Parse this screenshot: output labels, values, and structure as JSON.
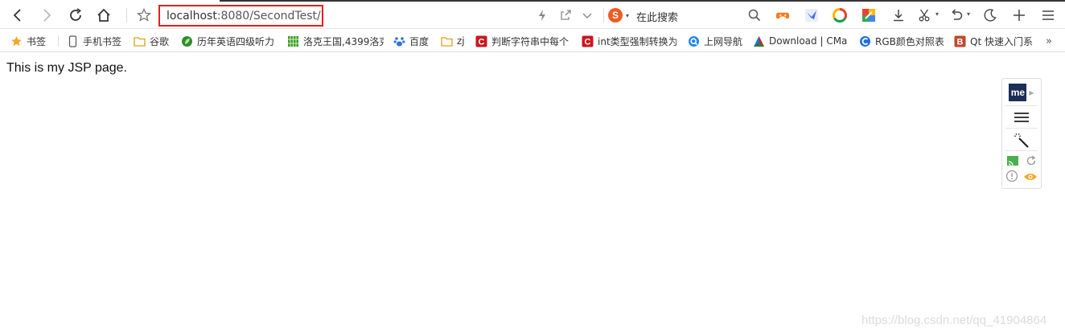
{
  "browser": {
    "address_host": "localhost",
    "address_rest": ":8080/SecondTest/",
    "search_engine_label": "在此搜索",
    "icons": [
      "back-icon",
      "forward-icon",
      "reload-icon",
      "home-icon",
      "star-icon",
      "lightning-icon",
      "share-icon",
      "chevron-down-icon",
      "sogou-icon",
      "search-icon",
      "game-icon",
      "bird-icon",
      "chrome-ring-icon",
      "colorful-icon",
      "download-icon",
      "scissors-icon",
      "undo-icon",
      "moon-icon",
      "plus-icon",
      "menu-icon"
    ]
  },
  "bookmarks": [
    {
      "label": "书签",
      "icon": "star-icon"
    },
    {
      "label": "手机书签",
      "icon": "phone-icon"
    },
    {
      "label": "谷歌",
      "icon": "folder-icon"
    },
    {
      "label": "历年英语四级听力",
      "icon": "leaf-icon"
    },
    {
      "label": "洛克王国,4399洛克",
      "icon": "grid-icon"
    },
    {
      "label": "百度",
      "icon": "paw-icon"
    },
    {
      "label": "zj",
      "icon": "folder-icon"
    },
    {
      "label": "判断字符串中每个",
      "icon": "csdn-icon"
    },
    {
      "label": "int类型强制转换为",
      "icon": "csdn-icon"
    },
    {
      "label": "上网导航",
      "icon": "q-icon"
    },
    {
      "label": "Download | CMak",
      "icon": "cmake-icon"
    },
    {
      "label": "RGB颜色对照表",
      "icon": "c-icon"
    },
    {
      "label": "Qt 快速入门系",
      "icon": "b-icon"
    }
  ],
  "page": {
    "text": "This is my JSP page."
  },
  "side_panel": {
    "badge": "me"
  },
  "watermark": "https://blog.csdn.net/qq_41904864"
}
